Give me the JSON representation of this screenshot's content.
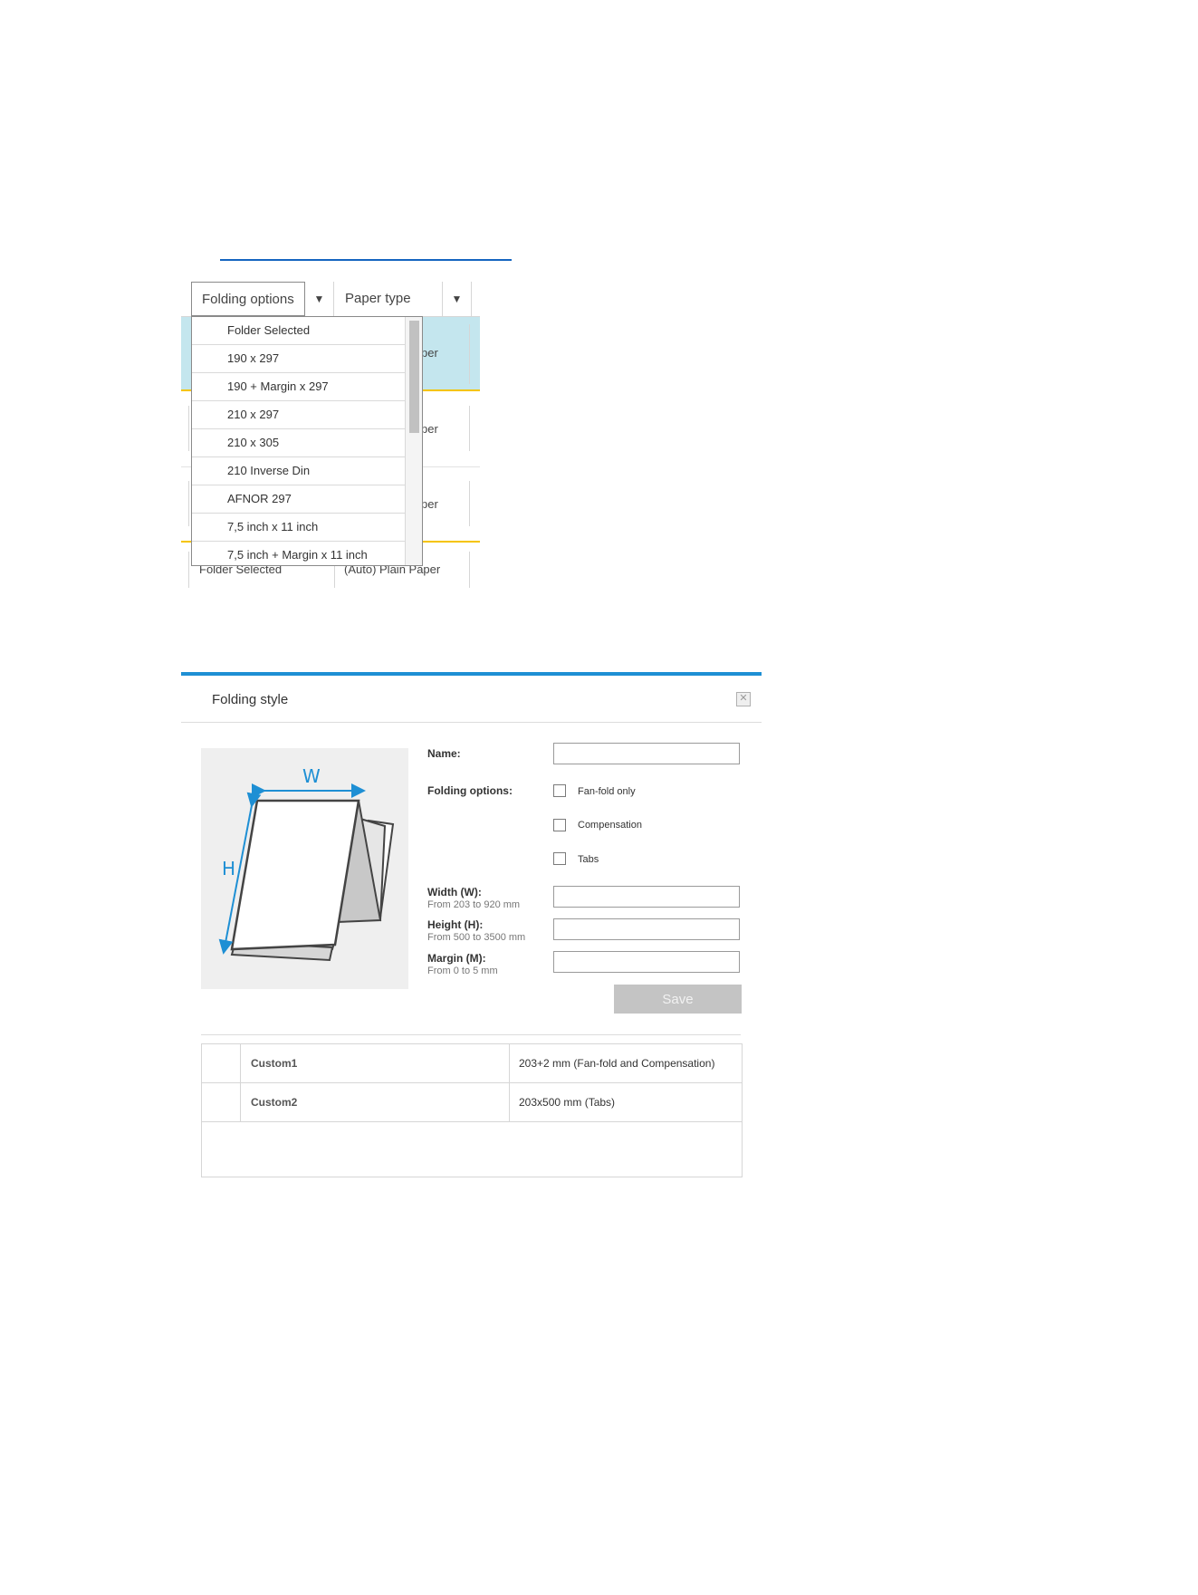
{
  "grid": {
    "header": {
      "folding_options": "Folding options",
      "paper_type": "Paper type",
      "filter_icon": "filter-icon"
    },
    "row_fragment": "per",
    "last_row": {
      "folding": "Folder Selected",
      "paper": "(Auto) Plain Paper"
    },
    "dropdown_items": [
      "Folder Selected",
      "190 x 297",
      "190 + Margin x 297",
      "210 x 297",
      "210 x 305",
      "210 Inverse Din",
      "AFNOR 297",
      "7,5 inch x 11 inch",
      "7,5 inch + Margin x 11 inch"
    ]
  },
  "dialog": {
    "title": "Folding style",
    "close_icon": "close-icon",
    "diagram": {
      "w_label": "W",
      "h_label": "H"
    },
    "name_label": "Name:",
    "folding_options_label": "Folding options:",
    "checkboxes": [
      "Fan-fold only",
      "Compensation",
      "Tabs"
    ],
    "width_label": "Width (W):",
    "width_hint": "From 203 to 920 mm",
    "height_label": "Height (H):",
    "height_hint": "From 500 to 3500 mm",
    "margin_label": "Margin (M):",
    "margin_hint": "From 0 to 5 mm",
    "save_label": "Save",
    "rows": [
      {
        "name": "Custom1",
        "desc": "203+2 mm (Fan-fold and Compensation)"
      },
      {
        "name": "Custom2",
        "desc": "203x500 mm (Tabs)"
      }
    ]
  },
  "colors": {
    "accent": "#1e8fd4",
    "selected_row": "#c4e6ee",
    "row_divider": "#f5c400",
    "save_disabled": "#c4c4c4"
  }
}
